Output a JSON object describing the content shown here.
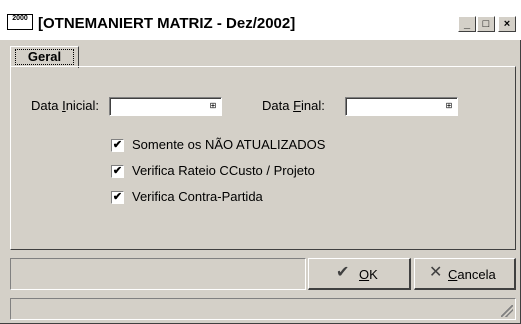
{
  "window": {
    "title": "[OTNEMANIERT MATRIZ - Dez/2002]",
    "icon_text": "2000",
    "controls": {
      "minimize": "_",
      "maximize": "□",
      "close": "×"
    }
  },
  "tabs": [
    {
      "label": "Geral",
      "active": true
    }
  ],
  "form": {
    "data_inicial": {
      "label_pre": "Data ",
      "label_u": "I",
      "label_post": "nicial:",
      "value": "",
      "calendar_icon": "calendar-icon"
    },
    "data_final": {
      "label_pre": "Data ",
      "label_u": "F",
      "label_post": "inal:",
      "value": "",
      "calendar_icon": "calendar-icon"
    },
    "checkboxes": [
      {
        "label": "Somente os NÃO ATUALIZADOS",
        "checked": true
      },
      {
        "label": "Verifica Rateio CCusto / Projeto",
        "checked": true
      },
      {
        "label": "Verifica Contra-Partida",
        "checked": true
      }
    ]
  },
  "buttons": {
    "ok": {
      "u": "O",
      "rest": "K",
      "icon": "check-icon"
    },
    "cancel": {
      "u": "C",
      "rest": "ancela",
      "icon": "x-icon"
    }
  },
  "glyphs": {
    "check": "✔",
    "cross": "✕",
    "calendar": "⊞"
  }
}
